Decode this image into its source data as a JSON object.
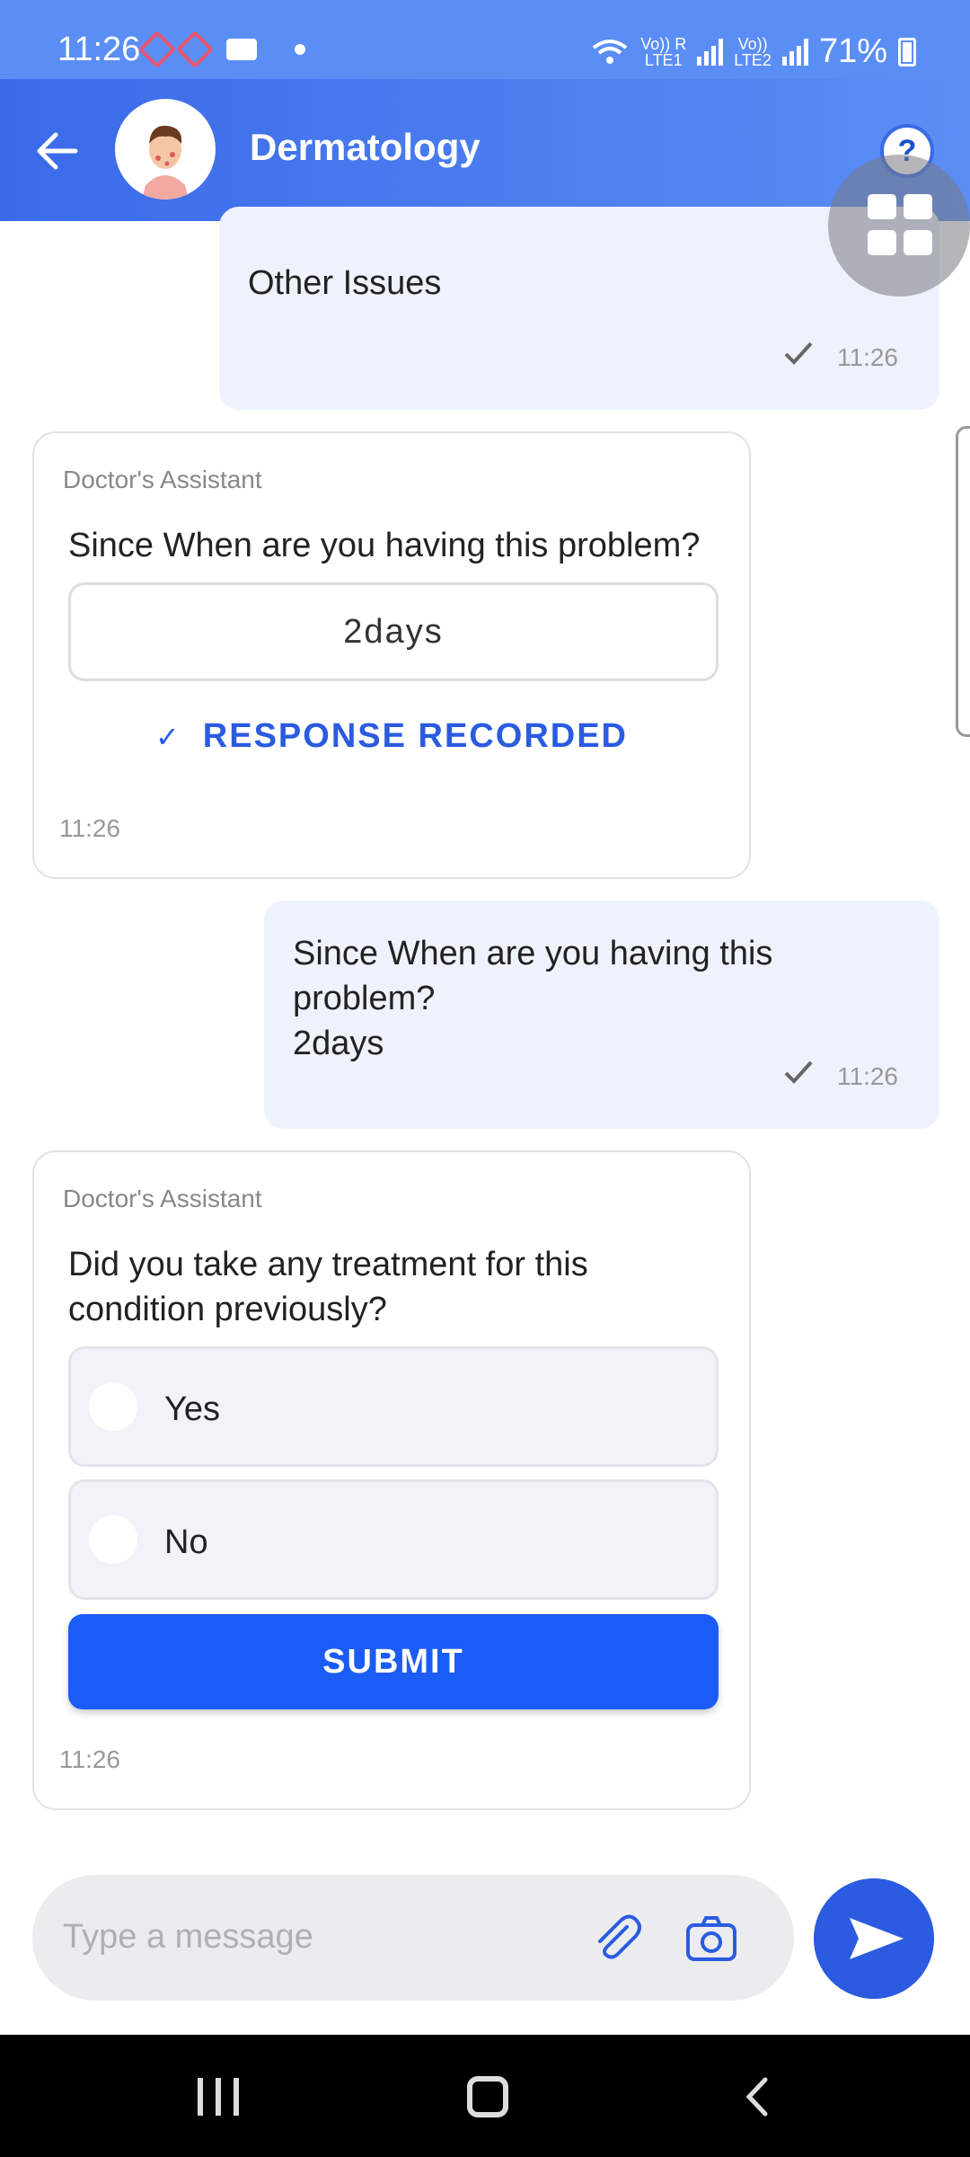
{
  "status_bar": {
    "time": "11:26",
    "battery": "71%",
    "sim1": "Vo)) R\nLTE1",
    "sim2": "Vo))\nLTE2"
  },
  "header": {
    "title": "Dermatology",
    "help_label": "?"
  },
  "messages": [
    {
      "type": "user",
      "text": "Other Issues",
      "time": "11:26",
      "status_icon": "check-icon"
    },
    {
      "type": "assistant",
      "sender": "Doctor's Assistant",
      "question": "Since When are you having this problem?",
      "answer": "2days",
      "status": "RESPONSE RECORDED",
      "time": "11:26"
    },
    {
      "type": "user",
      "text": "Since When are you having this problem?\n2days",
      "time": "11:26",
      "status_icon": "check-icon"
    },
    {
      "type": "assistant",
      "sender": "Doctor's Assistant",
      "question": "Did you take any treatment for this condition previously?",
      "options": [
        "Yes",
        "No"
      ],
      "submit_label": "SUBMIT",
      "time": "11:26"
    }
  ],
  "composer": {
    "placeholder": "Type a message"
  },
  "colors": {
    "primary": "#1a5cf5",
    "header": "#3a6ae8",
    "user_bubble": "#eef2fc",
    "recorded_text": "#2a5be0"
  }
}
